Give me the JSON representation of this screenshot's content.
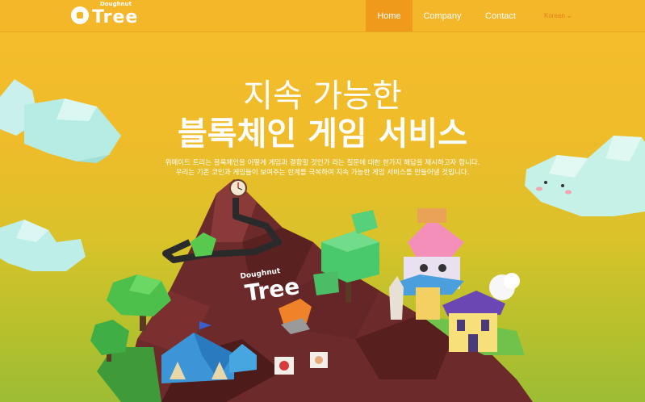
{
  "header": {
    "logo_small": "Doughnut",
    "logo_big": "Tree",
    "nav": [
      {
        "label": "Home",
        "active": true
      },
      {
        "label": "Company",
        "active": false
      },
      {
        "label": "Contact",
        "active": false
      }
    ],
    "language": "Korean"
  },
  "hero": {
    "title_line1": "지속 가능한",
    "title_line2": "블록체인 게임 서비스",
    "desc_line1": "위메이드 트리는 블록체인을 어떻게 게임과 결합할 것인가 라는 질문에 대한 한가지 해답을 제시하고자 합니다.",
    "desc_line2": "우리는 기존 코인과 게임들이 보여주는 한계를 극복하여 지속 가능한 게임 서비스를 만들어낼 것입니다."
  },
  "illustration": {
    "sign_small": "Doughnut",
    "sign_big": "Tree"
  },
  "colors": {
    "header_bg": "#f4b72a",
    "nav_active": "#f09a1c",
    "language_text": "#e07f1b"
  }
}
